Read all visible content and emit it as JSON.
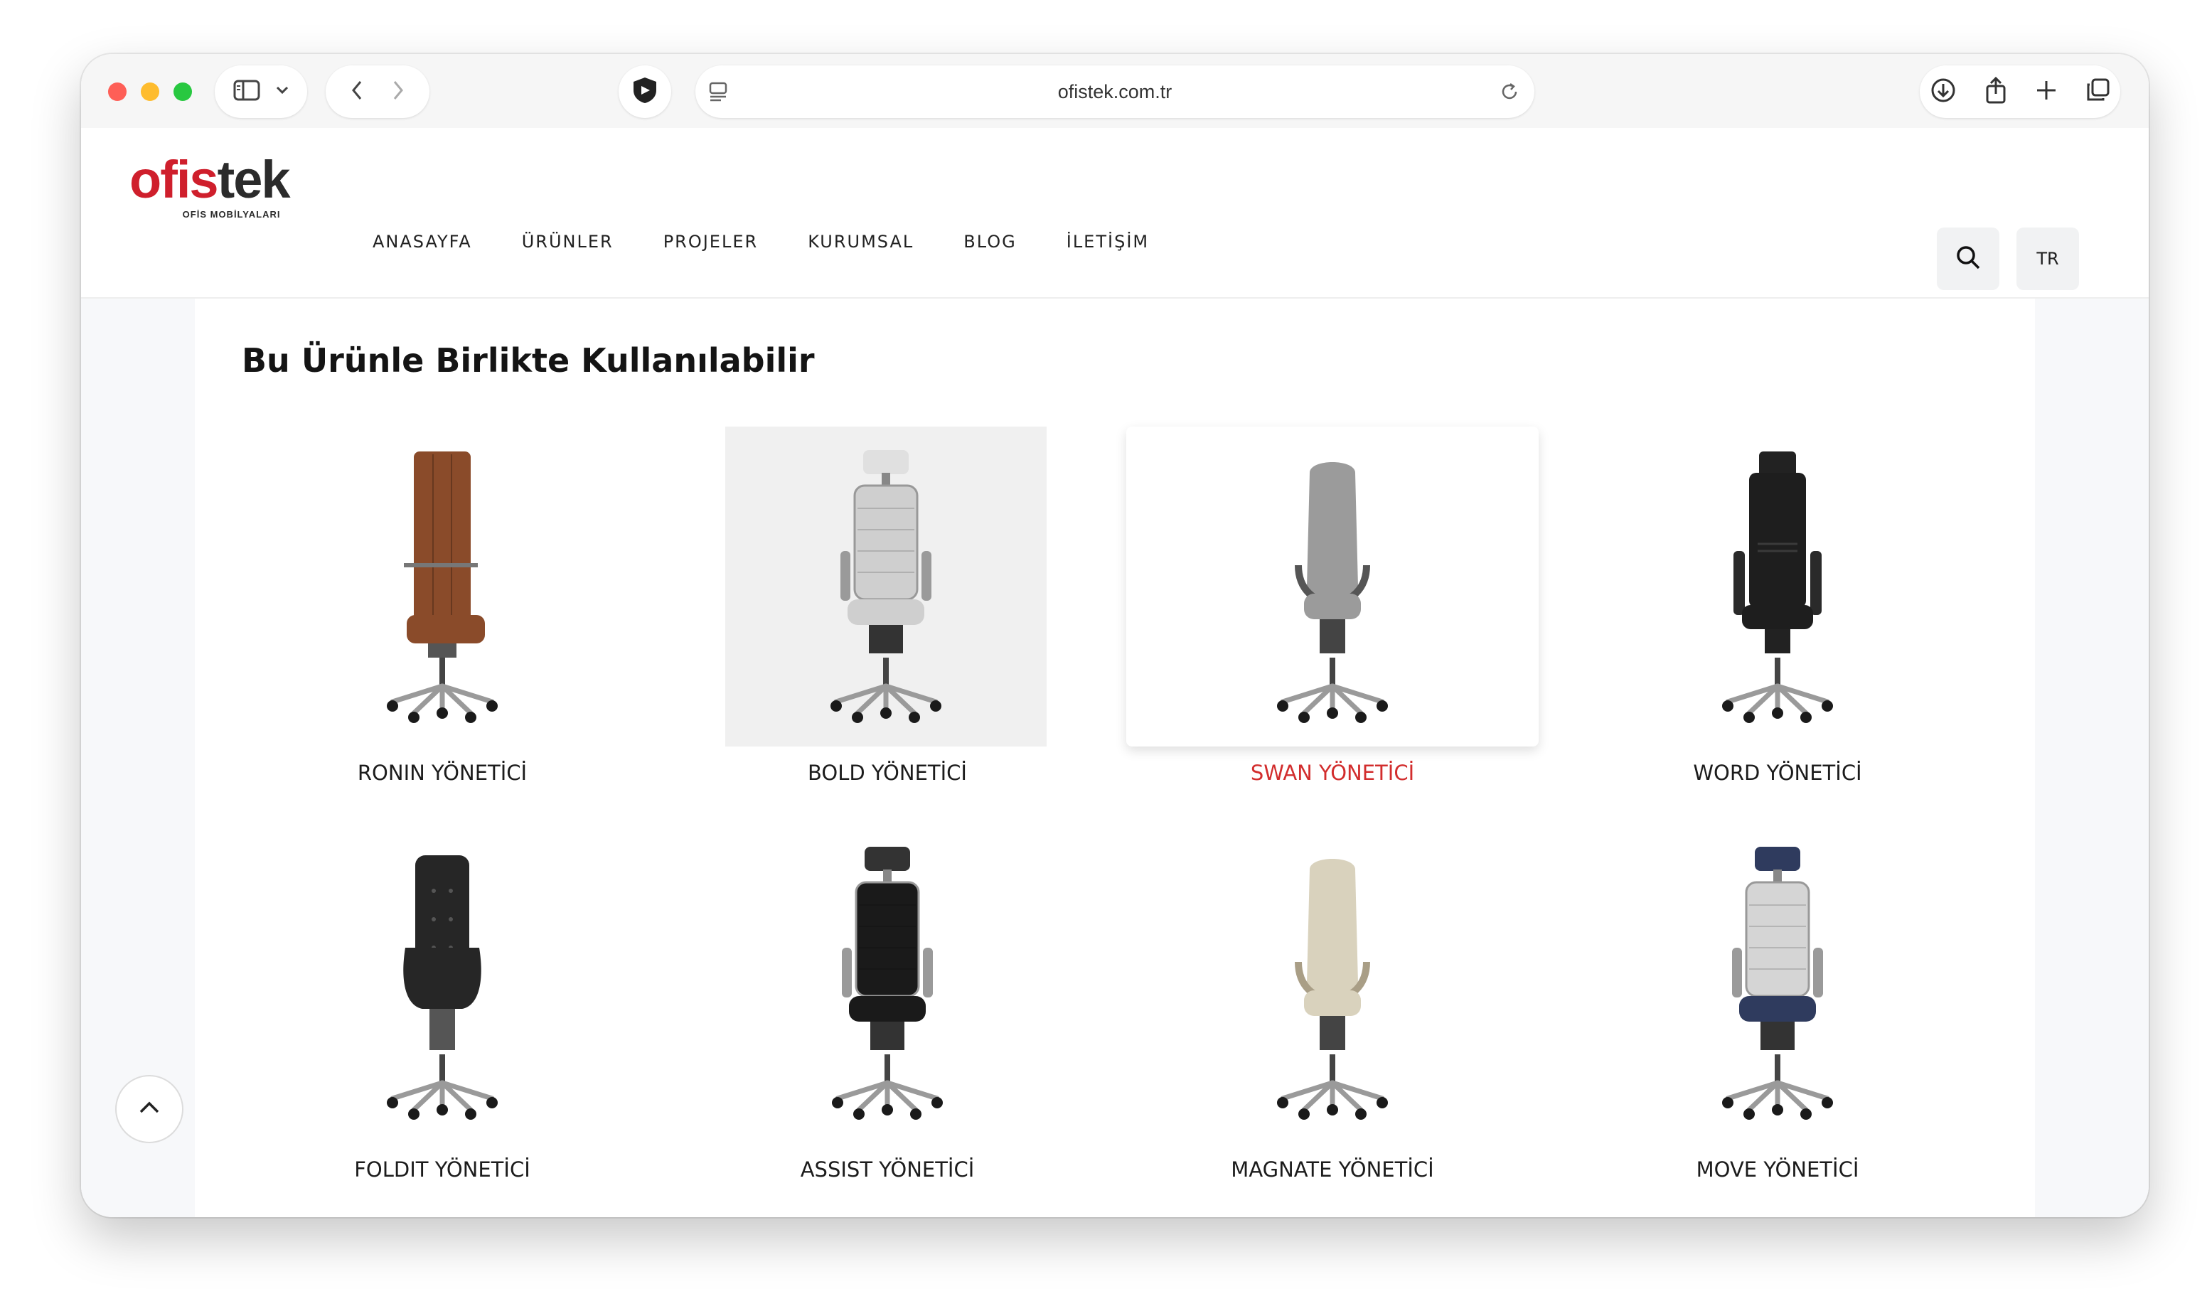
{
  "browser": {
    "url": "ofistek.com.tr"
  },
  "site": {
    "logo": {
      "part1": "ofis",
      "part2": "tek",
      "tagline": "OFİS MOBİLYALARI"
    },
    "nav": [
      "ANASAYFA",
      "ÜRÜNLER",
      "PROJELER",
      "KURUMSAL",
      "BLOG",
      "İLETİŞİM"
    ],
    "language": "TR"
  },
  "section": {
    "title": "Bu Ürünle Birlikte Kullanılabilir",
    "products": [
      {
        "name": "RONIN YÖNETİCİ",
        "color": "#8a4b2a",
        "style": "tall-leather"
      },
      {
        "name": "BOLD YÖNETİCİ",
        "color": "#cfcfcf",
        "style": "mesh-headrest"
      },
      {
        "name": "SWAN YÖNETİCİ",
        "color": "#9b9b9b",
        "style": "shell",
        "hover": true
      },
      {
        "name": "WORD YÖNETİCİ",
        "color": "#1e1e1e",
        "style": "executive"
      },
      {
        "name": "FOLDIT YÖNETİCİ",
        "color": "#262626",
        "style": "tufted"
      },
      {
        "name": "ASSIST YÖNETİCİ",
        "color": "#1a1a1a",
        "style": "mesh-headrest"
      },
      {
        "name": "MAGNATE YÖNETİCİ",
        "color": "#d9d2bd",
        "style": "shell"
      },
      {
        "name": "MOVE YÖNETİCİ",
        "color": "#2f3b5e",
        "style": "mesh-headrest"
      }
    ]
  }
}
